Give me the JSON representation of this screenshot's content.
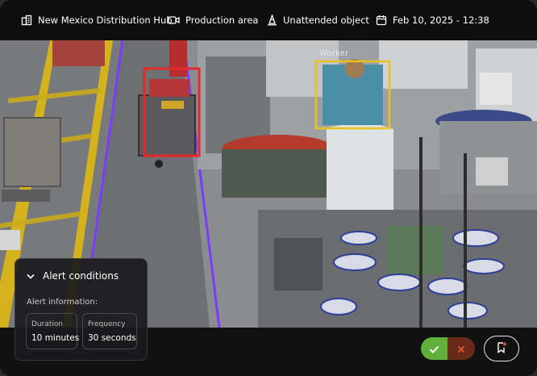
{
  "topbar": {
    "location": "New Mexico Distribution Hub",
    "area": "Production area",
    "alert_type": "Unattended object",
    "datetime": "Feb 10, 2025 - 12:38"
  },
  "detections": [
    {
      "label": "Worker",
      "color": "#e8c21e"
    },
    {
      "label": "",
      "color": "#e52828"
    }
  ],
  "boundary_color": "#7a3cff",
  "alert_panel": {
    "title": "Alert conditions",
    "subtitle": "Alert information:",
    "duration": {
      "title": "Duration",
      "value": "10 minutes"
    },
    "frequency": {
      "title": "Frequency",
      "value": "30 seconds"
    }
  },
  "actions": {
    "confirm_color": "#5fb13a",
    "reject_color": "#e8542c"
  }
}
